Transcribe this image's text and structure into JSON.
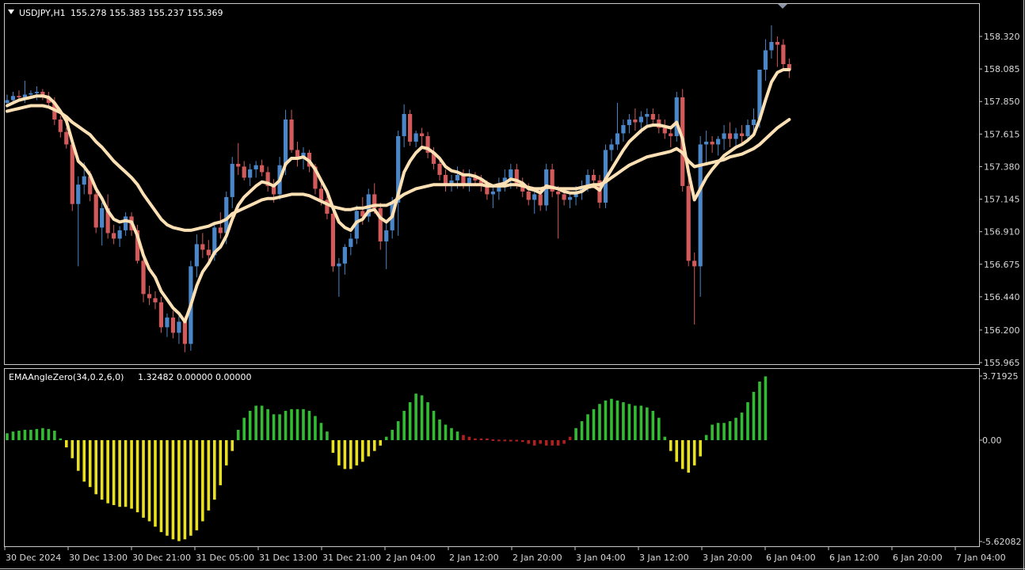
{
  "main": {
    "symbol": "USDJPY,H1",
    "ohlc": "155.278 155.383 155.237 155.369"
  },
  "indicator": {
    "name": "EMAAngleZero(34,0.2,6,0)",
    "values": "1.32482 0.00000 0.00000"
  },
  "chart_data": [
    {
      "type": "candlestick",
      "ylim": [
        155.965,
        158.4
      ],
      "ytick_labels": [
        "158.320",
        "158.085",
        "157.850",
        "157.615",
        "157.380",
        "157.145",
        "156.910",
        "156.675",
        "156.440",
        "156.200",
        "155.965"
      ],
      "xtick_labels": [
        "30 Dec 2024",
        "30 Dec 13:00",
        "30 Dec 21:00",
        "31 Dec 05:00",
        "31 Dec 13:00",
        "31 Dec 21:00",
        "2 Jan 04:00",
        "2 Jan 12:00",
        "2 Jan 20:00",
        "3 Jan 04:00",
        "3 Jan 12:00",
        "3 Jan 20:00",
        "6 Jan 04:00",
        "6 Jan 12:00",
        "6 Jan 20:00",
        "7 Jan 04:00"
      ],
      "colors": {
        "up": "#4a86c8",
        "down": "#d25a5a",
        "ema": "#fde0b4"
      },
      "ohlc": [
        [
          157.84,
          157.9,
          157.81,
          157.86
        ],
        [
          157.86,
          157.92,
          157.84,
          157.89
        ],
        [
          157.89,
          157.93,
          157.85,
          157.88
        ],
        [
          157.88,
          158.0,
          157.84,
          157.9
        ],
        [
          157.9,
          157.93,
          157.87,
          157.91
        ],
        [
          157.91,
          157.96,
          157.86,
          157.92
        ],
        [
          157.92,
          157.94,
          157.86,
          157.88
        ],
        [
          157.88,
          157.92,
          157.8,
          157.84
        ],
        [
          157.84,
          157.88,
          157.68,
          157.72
        ],
        [
          157.72,
          157.75,
          157.59,
          157.63
        ],
        [
          157.63,
          157.66,
          157.51,
          157.54
        ],
        [
          157.54,
          157.58,
          157.06,
          157.11
        ],
        [
          157.11,
          157.31,
          156.66,
          157.25
        ],
        [
          157.25,
          157.41,
          157.18,
          157.31
        ],
        [
          157.31,
          157.35,
          157.13,
          157.18
        ],
        [
          157.18,
          157.22,
          156.9,
          156.94
        ],
        [
          156.94,
          157.12,
          156.81,
          157.08
        ],
        [
          157.08,
          157.18,
          156.86,
          156.9
        ],
        [
          156.9,
          156.96,
          156.82,
          156.86
        ],
        [
          156.86,
          156.95,
          156.8,
          156.92
        ],
        [
          156.92,
          157.05,
          156.88,
          157.02
        ],
        [
          157.02,
          157.05,
          156.88,
          156.92
        ],
        [
          156.92,
          156.96,
          156.68,
          156.7
        ],
        [
          156.7,
          156.78,
          156.4,
          156.46
        ],
        [
          156.46,
          156.52,
          156.38,
          156.43
        ],
        [
          156.43,
          156.48,
          156.35,
          156.4
        ],
        [
          156.4,
          156.44,
          156.18,
          156.22
        ],
        [
          156.22,
          156.32,
          156.15,
          156.29
        ],
        [
          156.29,
          156.34,
          156.14,
          156.18
        ],
        [
          156.18,
          156.3,
          156.1,
          156.26
        ],
        [
          156.26,
          156.3,
          156.04,
          156.1
        ],
        [
          156.1,
          156.7,
          156.05,
          156.66
        ],
        [
          156.66,
          156.89,
          156.58,
          156.82
        ],
        [
          156.82,
          156.9,
          156.72,
          156.78
        ],
        [
          156.78,
          156.85,
          156.7,
          156.74
        ],
        [
          156.74,
          156.98,
          156.7,
          156.94
        ],
        [
          156.94,
          157.05,
          156.86,
          156.9
        ],
        [
          156.9,
          157.2,
          156.82,
          157.16
        ],
        [
          157.16,
          157.45,
          157.08,
          157.4
        ],
        [
          157.4,
          157.55,
          157.32,
          157.38
        ],
        [
          157.38,
          157.42,
          157.28,
          157.3
        ],
        [
          157.3,
          157.4,
          157.24,
          157.36
        ],
        [
          157.36,
          157.42,
          157.3,
          157.39
        ],
        [
          157.39,
          157.43,
          157.31,
          157.34
        ],
        [
          157.34,
          157.38,
          157.2,
          157.24
        ],
        [
          157.24,
          157.29,
          157.12,
          157.18
        ],
        [
          157.18,
          157.45,
          157.14,
          157.39
        ],
        [
          157.39,
          157.79,
          157.32,
          157.72
        ],
        [
          157.72,
          157.79,
          157.48,
          157.5
        ],
        [
          157.5,
          157.56,
          157.38,
          157.44
        ],
        [
          157.44,
          157.52,
          157.36,
          157.48
        ],
        [
          157.48,
          157.5,
          157.34,
          157.38
        ],
        [
          157.38,
          157.4,
          157.18,
          157.22
        ],
        [
          157.22,
          157.28,
          157.1,
          157.14
        ],
        [
          157.14,
          157.18,
          157.0,
          157.04
        ],
        [
          157.04,
          157.1,
          156.62,
          156.66
        ],
        [
          156.66,
          156.72,
          156.44,
          156.68
        ],
        [
          156.68,
          156.82,
          156.6,
          156.8
        ],
        [
          156.8,
          156.9,
          156.74,
          156.86
        ],
        [
          156.86,
          157.1,
          156.82,
          157.06
        ],
        [
          157.06,
          157.16,
          156.96,
          157.02
        ],
        [
          157.02,
          157.22,
          156.98,
          157.18
        ],
        [
          157.18,
          157.26,
          157.04,
          157.08
        ],
        [
          157.08,
          157.12,
          156.78,
          156.84
        ],
        [
          156.84,
          156.98,
          156.64,
          156.92
        ],
        [
          156.92,
          157.16,
          156.86,
          157.12
        ],
        [
          157.12,
          157.64,
          156.88,
          157.6
        ],
        [
          157.6,
          157.83,
          157.52,
          157.76
        ],
        [
          157.76,
          157.79,
          157.53,
          157.56
        ],
        [
          157.56,
          157.64,
          157.52,
          157.62
        ],
        [
          157.62,
          157.66,
          157.52,
          157.6
        ],
        [
          157.6,
          157.63,
          157.44,
          157.48
        ],
        [
          157.48,
          157.52,
          157.36,
          157.4
        ],
        [
          157.4,
          157.44,
          157.28,
          157.32
        ],
        [
          157.32,
          157.36,
          157.2,
          157.24
        ],
        [
          157.24,
          157.32,
          157.2,
          157.28
        ],
        [
          157.28,
          157.38,
          157.22,
          157.32
        ],
        [
          157.32,
          157.36,
          157.22,
          157.26
        ],
        [
          157.26,
          157.36,
          157.2,
          157.3
        ],
        [
          157.3,
          157.34,
          157.24,
          157.28
        ],
        [
          157.28,
          157.32,
          157.2,
          157.24
        ],
        [
          157.24,
          157.28,
          157.14,
          157.18
        ],
        [
          157.18,
          157.24,
          157.08,
          157.2
        ],
        [
          157.2,
          157.3,
          157.14,
          157.26
        ],
        [
          157.26,
          157.36,
          157.2,
          157.3
        ],
        [
          157.3,
          157.4,
          157.22,
          157.36
        ],
        [
          157.36,
          157.4,
          157.22,
          157.26
        ],
        [
          157.26,
          157.3,
          157.16,
          157.2
        ],
        [
          157.2,
          157.26,
          157.1,
          157.14
        ],
        [
          157.14,
          157.22,
          157.04,
          157.18
        ],
        [
          157.18,
          157.22,
          157.06,
          157.1
        ],
        [
          157.1,
          157.4,
          157.06,
          157.36
        ],
        [
          157.36,
          157.4,
          157.16,
          157.2
        ],
        [
          157.2,
          157.24,
          156.86,
          157.18
        ],
        [
          157.18,
          157.22,
          157.1,
          157.14
        ],
        [
          157.14,
          157.2,
          157.08,
          157.16
        ],
        [
          157.16,
          157.24,
          157.1,
          157.2
        ],
        [
          157.2,
          157.28,
          157.14,
          157.24
        ],
        [
          157.24,
          157.36,
          157.2,
          157.32
        ],
        [
          157.32,
          157.36,
          157.24,
          157.28
        ],
        [
          157.28,
          157.32,
          157.08,
          157.12
        ],
        [
          157.12,
          157.54,
          157.08,
          157.5
        ],
        [
          157.5,
          157.58,
          157.42,
          157.54
        ],
        [
          157.54,
          157.84,
          157.5,
          157.62
        ],
        [
          157.62,
          157.72,
          157.56,
          157.68
        ],
        [
          157.68,
          157.76,
          157.62,
          157.72
        ],
        [
          157.72,
          157.8,
          157.64,
          157.7
        ],
        [
          157.7,
          157.78,
          157.62,
          157.74
        ],
        [
          157.74,
          157.8,
          157.66,
          157.76
        ],
        [
          157.76,
          157.8,
          157.68,
          157.72
        ],
        [
          157.72,
          157.76,
          157.62,
          157.66
        ],
        [
          157.66,
          157.72,
          157.58,
          157.62
        ],
        [
          157.62,
          157.66,
          157.52,
          157.6
        ],
        [
          157.6,
          157.92,
          157.56,
          157.88
        ],
        [
          157.88,
          157.94,
          157.2,
          157.24
        ],
        [
          157.24,
          157.3,
          156.66,
          156.7
        ],
        [
          156.7,
          156.76,
          156.24,
          156.66
        ],
        [
          156.66,
          157.6,
          156.44,
          157.54
        ],
        [
          157.54,
          157.64,
          157.4,
          157.56
        ],
        [
          157.56,
          157.6,
          157.48,
          157.54
        ],
        [
          157.54,
          157.6,
          157.46,
          157.58
        ],
        [
          157.58,
          157.68,
          157.5,
          157.62
        ],
        [
          157.62,
          157.7,
          157.52,
          157.58
        ],
        [
          157.58,
          157.66,
          157.52,
          157.62
        ],
        [
          157.62,
          157.68,
          157.54,
          157.6
        ],
        [
          157.6,
          157.72,
          157.56,
          157.68
        ],
        [
          157.68,
          157.8,
          157.62,
          157.72
        ],
        [
          157.72,
          157.88,
          157.66,
          158.08
        ],
        [
          158.08,
          158.3,
          158.0,
          158.22
        ],
        [
          158.22,
          158.4,
          158.16,
          158.28
        ],
        [
          158.28,
          158.32,
          158.1,
          158.26
        ],
        [
          158.26,
          158.3,
          158.08,
          158.12
        ],
        [
          158.12,
          158.16,
          158.02,
          158.08
        ]
      ],
      "ema_fast": [
        157.82,
        157.84,
        157.86,
        157.87,
        157.88,
        157.89,
        157.89,
        157.88,
        157.84,
        157.78,
        157.71,
        157.56,
        157.42,
        157.38,
        157.32,
        157.22,
        157.15,
        157.06,
        157.0,
        156.98,
        156.99,
        156.98,
        156.88,
        156.74,
        156.64,
        156.58,
        156.48,
        156.42,
        156.36,
        156.32,
        156.26,
        156.38,
        156.52,
        156.62,
        156.68,
        156.76,
        156.8,
        156.88,
        157.0,
        157.1,
        157.16,
        157.2,
        157.24,
        157.27,
        157.26,
        157.24,
        157.28,
        157.4,
        157.44,
        157.44,
        157.45,
        157.42,
        157.36,
        157.28,
        157.2,
        157.08,
        156.98,
        156.94,
        156.92,
        156.98,
        157.0,
        157.06,
        157.07,
        157.01,
        156.98,
        157.02,
        157.18,
        157.34,
        157.42,
        157.48,
        157.52,
        157.51,
        157.48,
        157.44,
        157.38,
        157.35,
        157.34,
        157.32,
        157.32,
        157.31,
        157.29,
        157.26,
        157.24,
        157.25,
        157.26,
        157.29,
        157.28,
        157.26,
        157.22,
        157.21,
        157.19,
        157.24,
        157.23,
        157.22,
        157.2,
        157.19,
        157.19,
        157.2,
        157.23,
        157.24,
        157.21,
        157.29,
        157.36,
        157.43,
        157.5,
        157.56,
        157.6,
        157.64,
        157.67,
        157.68,
        157.68,
        157.67,
        157.66,
        157.7,
        157.58,
        157.34,
        157.14,
        157.22,
        157.3,
        157.36,
        157.41,
        157.46,
        157.49,
        157.52,
        157.54,
        157.57,
        157.61,
        157.72,
        157.86,
        157.99,
        158.06,
        158.08,
        158.08
      ],
      "ema_slow": [
        157.78,
        157.79,
        157.8,
        157.81,
        157.82,
        157.82,
        157.82,
        157.81,
        157.79,
        157.77,
        157.74,
        157.7,
        157.67,
        157.64,
        157.61,
        157.56,
        157.52,
        157.47,
        157.42,
        157.38,
        157.34,
        157.3,
        157.25,
        157.18,
        157.12,
        157.06,
        157.0,
        156.96,
        156.94,
        156.93,
        156.92,
        156.92,
        156.93,
        156.94,
        156.95,
        156.97,
        156.98,
        157.0,
        157.04,
        157.06,
        157.08,
        157.1,
        157.12,
        157.14,
        157.15,
        157.15,
        157.16,
        157.17,
        157.18,
        157.18,
        157.18,
        157.17,
        157.15,
        157.13,
        157.11,
        157.09,
        157.08,
        157.07,
        157.07,
        157.08,
        157.08,
        157.09,
        157.1,
        157.1,
        157.1,
        157.12,
        157.15,
        157.18,
        157.2,
        157.22,
        157.23,
        157.24,
        157.25,
        157.25,
        157.25,
        157.25,
        157.25,
        157.25,
        157.25,
        157.25,
        157.25,
        157.24,
        157.24,
        157.24,
        157.24,
        157.25,
        157.25,
        157.24,
        157.23,
        157.22,
        157.22,
        157.23,
        157.23,
        157.22,
        157.22,
        157.22,
        157.22,
        157.23,
        157.24,
        157.25,
        157.25,
        157.27,
        157.3,
        157.33,
        157.36,
        157.39,
        157.41,
        157.43,
        157.45,
        157.46,
        157.47,
        157.48,
        157.49,
        157.51,
        157.48,
        157.42,
        157.38,
        157.39,
        157.4,
        157.41,
        157.42,
        157.43,
        157.45,
        157.46,
        157.47,
        157.49,
        157.51,
        157.54,
        157.58,
        157.62,
        157.66,
        157.69,
        157.72
      ]
    },
    {
      "type": "bar",
      "ylim": [
        -5.62082,
        3.71925
      ],
      "ytick_labels": [
        "3.71925",
        "0.00",
        "-5.62082"
      ],
      "colors": {
        "up": "#33bb33",
        "down": "#e8e020",
        "flat": "#b02020"
      },
      "values": [
        0.4,
        0.5,
        0.55,
        0.6,
        0.6,
        0.65,
        0.7,
        0.65,
        0.55,
        0.1,
        -0.4,
        -1.0,
        -1.7,
        -2.3,
        -2.6,
        -3.0,
        -3.3,
        -3.5,
        -3.6,
        -3.7,
        -3.7,
        -3.8,
        -4.0,
        -4.3,
        -4.5,
        -4.8,
        -5.1,
        -5.3,
        -5.5,
        -5.6,
        -5.5,
        -5.3,
        -5.0,
        -4.5,
        -3.9,
        -3.3,
        -2.5,
        -1.4,
        -0.6,
        0.6,
        1.3,
        1.7,
        2.0,
        2.0,
        1.8,
        1.5,
        1.5,
        1.7,
        1.8,
        1.8,
        1.8,
        1.7,
        1.4,
        1.0,
        0.5,
        -0.7,
        -1.4,
        -1.6,
        -1.6,
        -1.4,
        -1.2,
        -0.9,
        -0.6,
        -0.3,
        0.2,
        0.6,
        1.1,
        1.7,
        2.2,
        2.7,
        2.6,
        2.2,
        1.7,
        1.2,
        0.9,
        0.7,
        0.5,
        0.3,
        0.2,
        0.1,
        0.1,
        0.1,
        0.05,
        0.03,
        0.03,
        0.02,
        0.02,
        -0.1,
        -0.2,
        -0.3,
        -0.2,
        -0.3,
        -0.3,
        -0.3,
        -0.2,
        0.2,
        0.7,
        1.1,
        1.5,
        1.8,
        2.1,
        2.3,
        2.4,
        2.3,
        2.2,
        2.1,
        2.0,
        2.0,
        1.9,
        1.7,
        1.3,
        0.2,
        -0.6,
        -1.2,
        -1.6,
        -1.8,
        -1.4,
        -0.9,
        0.3,
        0.9,
        1.0,
        1.0,
        1.1,
        1.3,
        1.6,
        2.2,
        2.8,
        3.4,
        3.7
      ]
    }
  ]
}
